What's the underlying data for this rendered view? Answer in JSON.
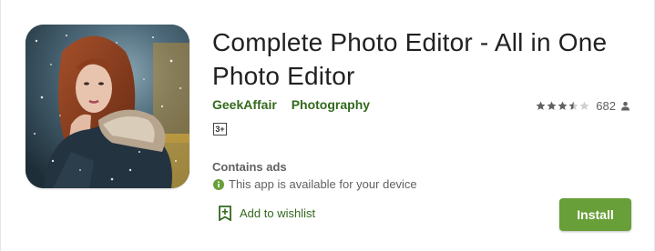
{
  "app": {
    "title": "Complete Photo Editor - All in One Photo Editor",
    "developer": "GeekAffair",
    "category": "Photography",
    "rating_value": 3.5,
    "rating_max": 5,
    "rating_count": "682",
    "content_rating": "3+",
    "contains_ads": "Contains ads",
    "availability": "This app is available for your device",
    "wishlist_label": "Add to wishlist",
    "install_label": "Install"
  },
  "icons": {
    "app_icon": "app-icon-portrait",
    "star": "star-icon",
    "person": "person-icon",
    "info": "info-icon",
    "wishlist": "bookmark-add-icon"
  },
  "colors": {
    "accent_green": "#689f38",
    "link_green": "#33691e",
    "text_gray": "#616161",
    "info_green": "#689f38"
  }
}
